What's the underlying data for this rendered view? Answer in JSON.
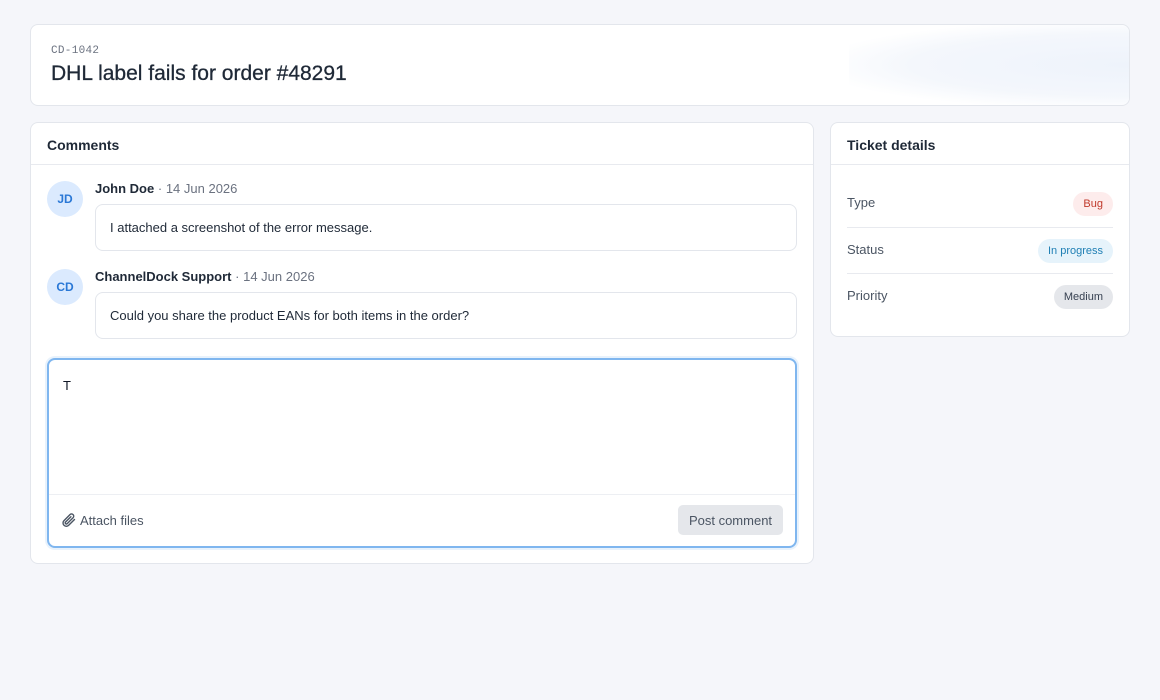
{
  "ticket": {
    "id": "CD-1042",
    "title": "DHL label fails for order #48291"
  },
  "comments_panel": {
    "title": "Comments",
    "comments": [
      {
        "initials": "JD",
        "author": "John Doe",
        "separator": "·",
        "date": "14 Jun 2026",
        "text": "I attached a screenshot of the error message."
      },
      {
        "initials": "CD",
        "author": "ChannelDock Support",
        "separator": "·",
        "date": "14 Jun 2026",
        "text": "Could you share the product EANs for both items in the order?"
      }
    ],
    "editor": {
      "value": "T",
      "attach_label": "Attach files",
      "attach_icon": "paperclip-icon",
      "post_label": "Post comment"
    }
  },
  "details_panel": {
    "title": "Ticket details",
    "rows": [
      {
        "label": "Type",
        "value": "Bug",
        "badge_bg": "#fdecec",
        "badge_color": "#c0392b"
      },
      {
        "label": "Status",
        "value": "In progress",
        "badge_bg": "#e6f3fb",
        "badge_color": "#1f7fb4"
      },
      {
        "label": "Priority",
        "value": "Medium",
        "badge_bg": "#e5e7eb",
        "badge_color": "#374151"
      }
    ]
  },
  "colors": {
    "accent": "#2a78d6",
    "focus_ring": "#7fb6ef",
    "page_bg": "#f5f6fa"
  }
}
